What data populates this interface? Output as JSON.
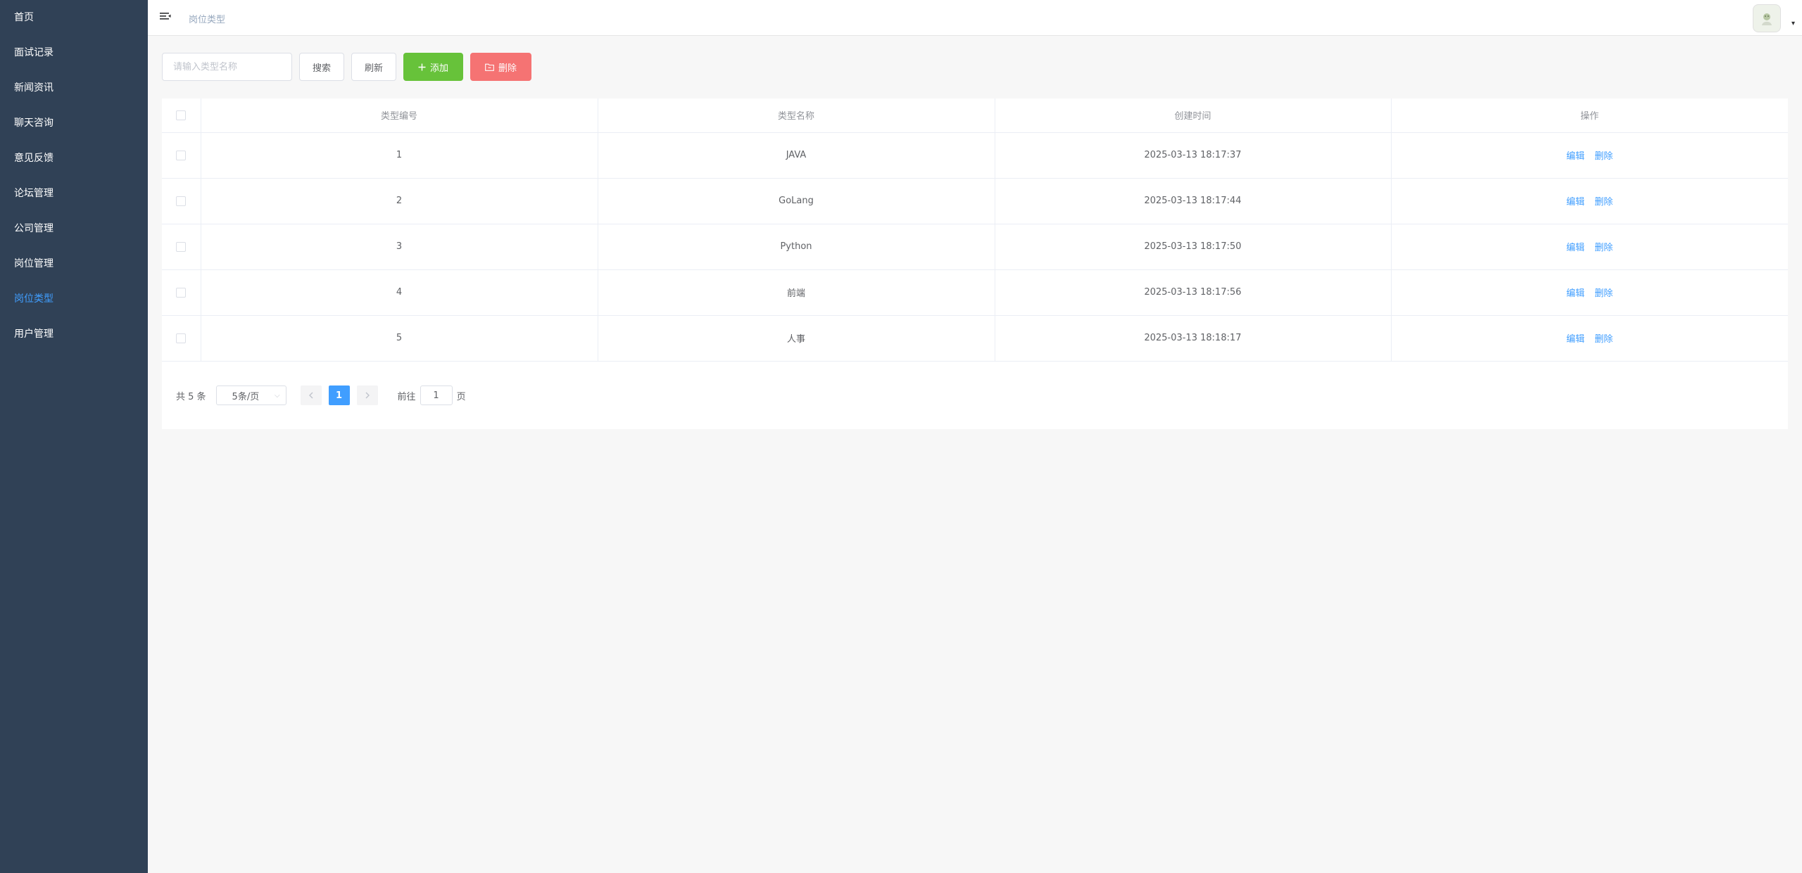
{
  "sidebar": {
    "items": [
      {
        "label": "首页"
      },
      {
        "label": "面试记录"
      },
      {
        "label": "新闻资讯"
      },
      {
        "label": "聊天咨询"
      },
      {
        "label": "意见反馈"
      },
      {
        "label": "论坛管理"
      },
      {
        "label": "公司管理"
      },
      {
        "label": "岗位管理"
      },
      {
        "label": "岗位类型",
        "active": true
      },
      {
        "label": "用户管理"
      }
    ]
  },
  "header": {
    "breadcrumb": "岗位类型"
  },
  "toolbar": {
    "search_placeholder": "请输入类型名称",
    "search_label": "搜索",
    "refresh_label": "刷新",
    "add_label": "添加",
    "delete_label": "删除"
  },
  "table": {
    "columns": [
      "类型编号",
      "类型名称",
      "创建时间",
      "操作"
    ],
    "rows": [
      {
        "id": "1",
        "name": "JAVA",
        "created": "2025-03-13 18:17:37"
      },
      {
        "id": "2",
        "name": "GoLang",
        "created": "2025-03-13 18:17:44"
      },
      {
        "id": "3",
        "name": "Python",
        "created": "2025-03-13 18:17:50"
      },
      {
        "id": "4",
        "name": "前端",
        "created": "2025-03-13 18:17:56"
      },
      {
        "id": "5",
        "name": "人事",
        "created": "2025-03-13 18:18:17"
      }
    ],
    "edit_label": "编辑",
    "delete_label": "删除"
  },
  "pagination": {
    "total": "共 5 条",
    "page_size": "5条/页",
    "current_page": "1",
    "goto_prefix": "前往",
    "goto_value": "1",
    "goto_suffix": "页"
  },
  "colors": {
    "sidebar_bg": "#304156",
    "accent": "#409eff",
    "add_button": "#67c23a",
    "delete_button": "#f56c6c"
  }
}
